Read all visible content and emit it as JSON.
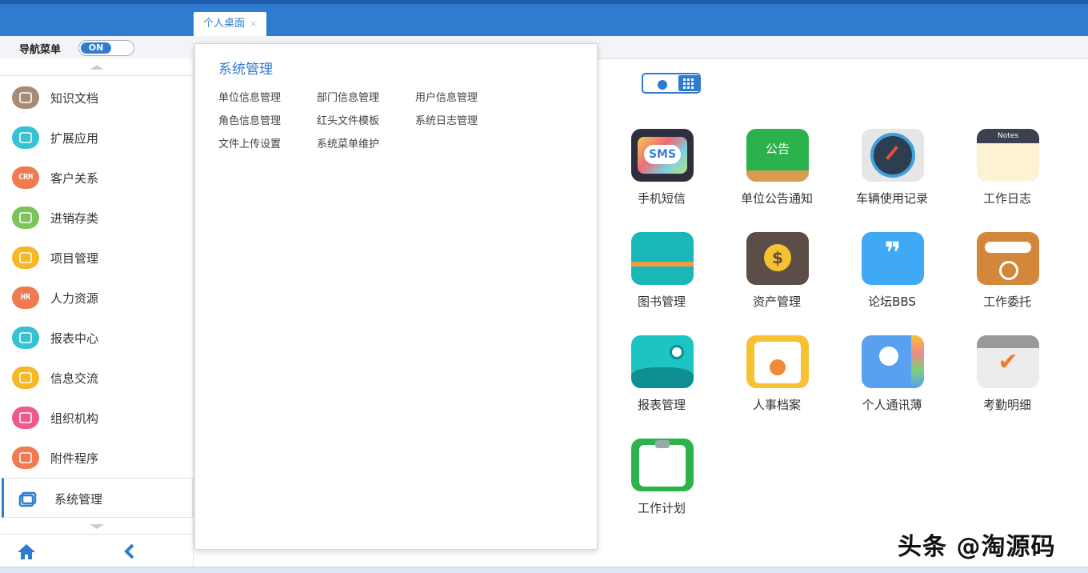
{
  "header": {
    "tab_label": "个人桌面",
    "tab_close": "×"
  },
  "nav": {
    "label": "导航菜单",
    "toggle": "ON"
  },
  "sidebar": {
    "items": [
      {
        "label": "知识文档",
        "icon": "book-icon",
        "color": "#a98a74",
        "text": ""
      },
      {
        "label": "扩展应用",
        "icon": "extension-icon",
        "color": "#37c2d4",
        "text": ""
      },
      {
        "label": "客户关系",
        "icon": "crm-icon",
        "color": "#f07a52",
        "text": "CRM"
      },
      {
        "label": "进销存类",
        "icon": "inventory-icon",
        "color": "#7cc35a",
        "text": ""
      },
      {
        "label": "项目管理",
        "icon": "project-icon",
        "color": "#f6b825",
        "text": ""
      },
      {
        "label": "人力资源",
        "icon": "hr-icon",
        "color": "#f07a52",
        "text": "HR"
      },
      {
        "label": "报表中心",
        "icon": "report-chart-icon",
        "color": "#37c2d4",
        "text": ""
      },
      {
        "label": "信息交流",
        "icon": "message-icon",
        "color": "#f6b825",
        "text": ""
      },
      {
        "label": "组织机构",
        "icon": "organization-icon",
        "color": "#ee5a8b",
        "text": ""
      },
      {
        "label": "附件程序",
        "icon": "attachment-icon",
        "color": "#f07a52",
        "text": ""
      },
      {
        "label": "系统管理",
        "icon": "window-icon",
        "color": "#2f7bd0",
        "text": ""
      }
    ]
  },
  "popup": {
    "title": "系统管理",
    "links": [
      [
        "单位信息管理",
        "部门信息管理",
        "用户信息管理"
      ],
      [
        "角色信息管理",
        "红头文件模板",
        "系统日志管理"
      ],
      [
        "文件上传设置",
        "系统菜单维护"
      ]
    ]
  },
  "apps": [
    {
      "label": "手机短信",
      "icon": "sms-icon",
      "ico_text": "SMS"
    },
    {
      "label": "单位公告通知",
      "icon": "announcement-icon",
      "ico_text": "公告"
    },
    {
      "label": "车辆使用记录",
      "icon": "speedometer-icon",
      "ico_text": ""
    },
    {
      "label": "工作日志",
      "icon": "notes-icon",
      "ico_text": "Notes"
    },
    {
      "label": "图书管理",
      "icon": "library-book-icon",
      "ico_text": ""
    },
    {
      "label": "资产管理",
      "icon": "wallet-icon",
      "ico_text": "$"
    },
    {
      "label": "论坛BBS",
      "icon": "forum-quote-icon",
      "ico_text": "❞"
    },
    {
      "label": "工作委托",
      "icon": "delegate-icon",
      "ico_text": ""
    },
    {
      "label": "报表管理",
      "icon": "report-wave-icon",
      "ico_text": ""
    },
    {
      "label": "人事档案",
      "icon": "personnel-file-icon",
      "ico_text": ""
    },
    {
      "label": "个人通讯薄",
      "icon": "contacts-icon",
      "ico_text": ""
    },
    {
      "label": "考勤明细",
      "icon": "attendance-calendar-icon",
      "ico_text": "✔"
    },
    {
      "label": "工作计划",
      "icon": "clipboard-icon",
      "ico_text": ""
    }
  ],
  "watermark": "头条 @淘源码"
}
